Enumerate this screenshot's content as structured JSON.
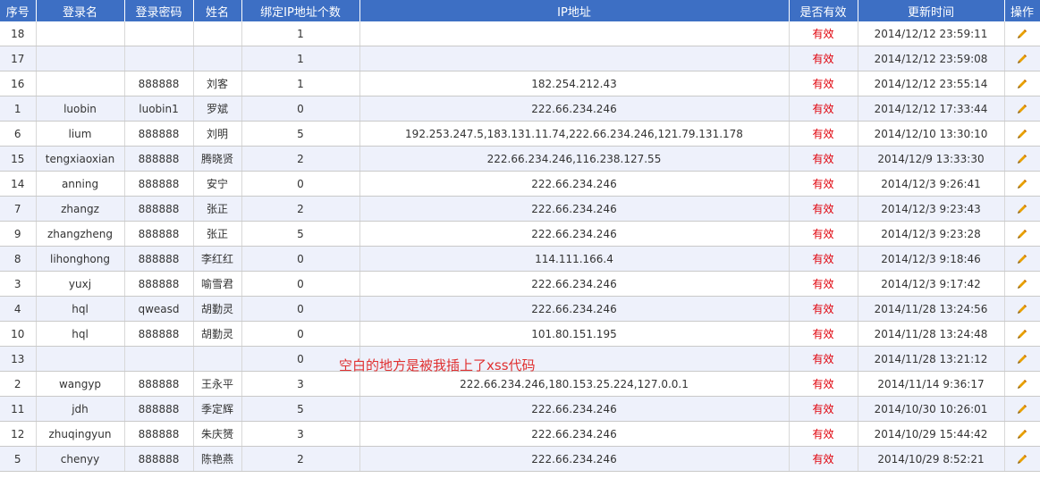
{
  "table": {
    "headers": [
      "序号",
      "登录名",
      "登录密码",
      "姓名",
      "绑定IP地址个数",
      "IP地址",
      "是否有效",
      "更新时间",
      "操作"
    ],
    "rows": [
      {
        "id": "18",
        "login": "",
        "password": "",
        "name": "",
        "ip_count": "1",
        "ip": "",
        "valid": "有效",
        "updated": "2014/12/12 23:59:11"
      },
      {
        "id": "17",
        "login": "",
        "password": "",
        "name": "",
        "ip_count": "1",
        "ip": "",
        "valid": "有效",
        "updated": "2014/12/12 23:59:08"
      },
      {
        "id": "16",
        "login": "",
        "password": "888888",
        "name": "刘客",
        "ip_count": "1",
        "ip": "182.254.212.43",
        "valid": "有效",
        "updated": "2014/12/12 23:55:14"
      },
      {
        "id": "1",
        "login": "luobin",
        "password": "luobin1",
        "name": "罗斌",
        "ip_count": "0",
        "ip": "222.66.234.246",
        "valid": "有效",
        "updated": "2014/12/12 17:33:44"
      },
      {
        "id": "6",
        "login": "lium",
        "password": "888888",
        "name": "刘明",
        "ip_count": "5",
        "ip": "192.253.247.5,183.131.11.74,222.66.234.246,121.79.131.178",
        "valid": "有效",
        "updated": "2014/12/10 13:30:10"
      },
      {
        "id": "15",
        "login": "tengxiaoxian",
        "password": "888888",
        "name": "腾晓贤",
        "ip_count": "2",
        "ip": "222.66.234.246,116.238.127.55",
        "valid": "有效",
        "updated": "2014/12/9 13:33:30"
      },
      {
        "id": "14",
        "login": "anning",
        "password": "888888",
        "name": "安宁",
        "ip_count": "0",
        "ip": "222.66.234.246",
        "valid": "有效",
        "updated": "2014/12/3 9:26:41"
      },
      {
        "id": "7",
        "login": "zhangz",
        "password": "888888",
        "name": "张正",
        "ip_count": "2",
        "ip": "222.66.234.246",
        "valid": "有效",
        "updated": "2014/12/3 9:23:43"
      },
      {
        "id": "9",
        "login": "zhangzheng",
        "password": "888888",
        "name": "张正",
        "ip_count": "5",
        "ip": "222.66.234.246",
        "valid": "有效",
        "updated": "2014/12/3 9:23:28"
      },
      {
        "id": "8",
        "login": "lihonghong",
        "password": "888888",
        "name": "李红红",
        "ip_count": "0",
        "ip": "114.111.166.4",
        "valid": "有效",
        "updated": "2014/12/3 9:18:46"
      },
      {
        "id": "3",
        "login": "yuxj",
        "password": "888888",
        "name": "喻雪君",
        "ip_count": "0",
        "ip": "222.66.234.246",
        "valid": "有效",
        "updated": "2014/12/3 9:17:42"
      },
      {
        "id": "4",
        "login": "hql",
        "password": "qweasd",
        "name": "胡勤灵",
        "ip_count": "0",
        "ip": "222.66.234.246",
        "valid": "有效",
        "updated": "2014/11/28 13:24:56"
      },
      {
        "id": "10",
        "login": "hql",
        "password": "888888",
        "name": "胡勤灵",
        "ip_count": "0",
        "ip": "101.80.151.195",
        "valid": "有效",
        "updated": "2014/11/28 13:24:48"
      },
      {
        "id": "13",
        "login": "",
        "password": "",
        "name": "",
        "ip_count": "0",
        "ip": "",
        "valid": "有效",
        "updated": "2014/11/28 13:21:12"
      },
      {
        "id": "2",
        "login": "wangyp",
        "password": "888888",
        "name": "王永平",
        "ip_count": "3",
        "ip": "222.66.234.246,180.153.25.224,127.0.0.1",
        "valid": "有效",
        "updated": "2014/11/14 9:36:17"
      },
      {
        "id": "11",
        "login": "jdh",
        "password": "888888",
        "name": "季定辉",
        "ip_count": "5",
        "ip": "222.66.234.246",
        "valid": "有效",
        "updated": "2014/10/30 10:26:01"
      },
      {
        "id": "12",
        "login": "zhuqingyun",
        "password": "888888",
        "name": "朱庆赟",
        "ip_count": "3",
        "ip": "222.66.234.246",
        "valid": "有效",
        "updated": "2014/10/29 15:44:42"
      },
      {
        "id": "5",
        "login": "chenyy",
        "password": "888888",
        "name": "陈艳燕",
        "ip_count": "2",
        "ip": "222.66.234.246",
        "valid": "有效",
        "updated": "2014/10/29 8:52:21"
      }
    ]
  },
  "annotation": "空白的地方是被我插上了xss代码",
  "icons": {
    "edit": "pencil-icon"
  },
  "colors": {
    "header_bg": "#3d6fc4",
    "status_text": "#e0000a",
    "annotation_text": "#e03030"
  }
}
